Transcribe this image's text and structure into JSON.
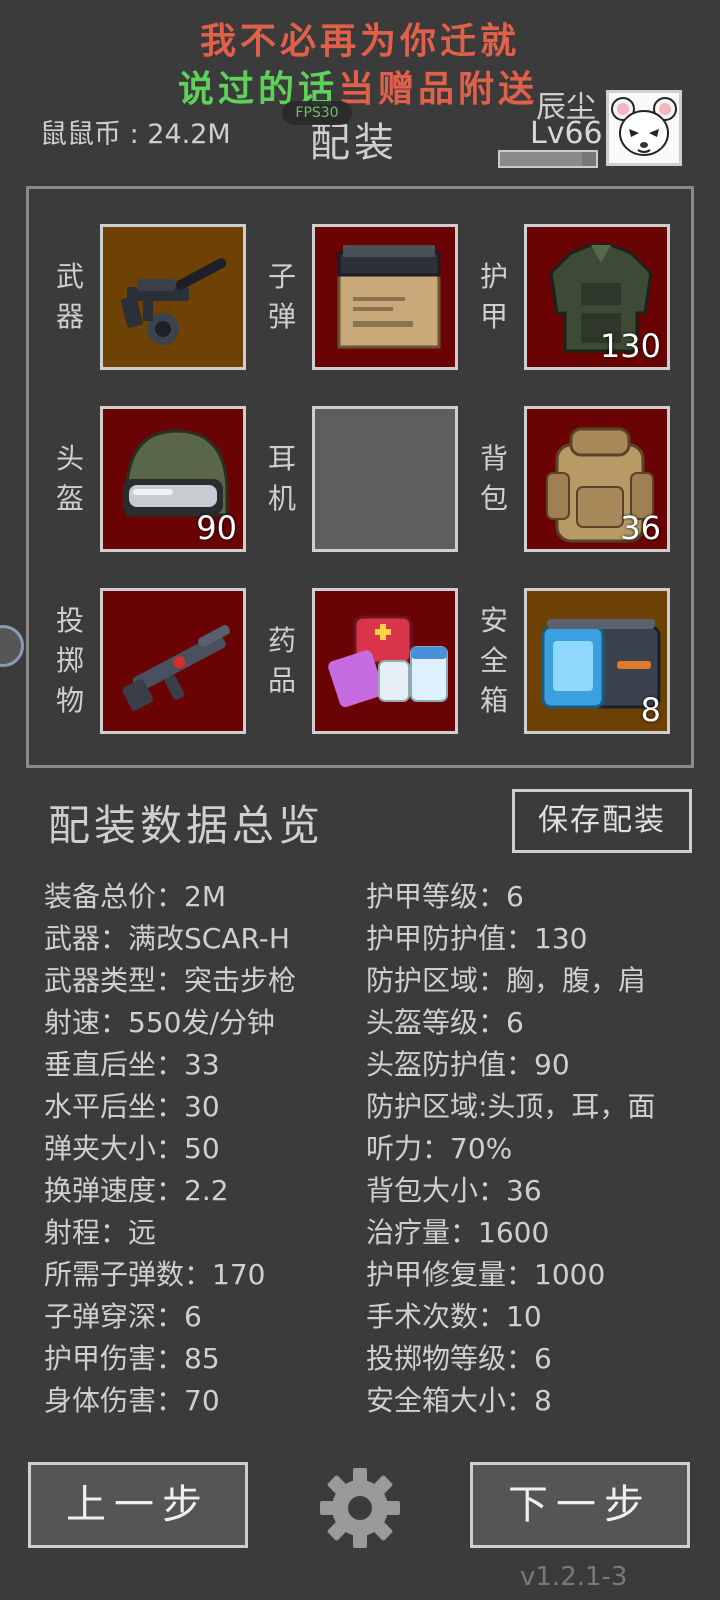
{
  "banner": {
    "line1": "我不必再为你迁就",
    "line2_green": "说过的话",
    "line2_red": "当赠品附送"
  },
  "header": {
    "coins_label": "鼠鼠币",
    "coins_sep": ":",
    "coins_value": "24.2M",
    "fps": "FPS30",
    "title": "配装",
    "username": "辰尘",
    "level": "Lv66",
    "avatar_icon": "mouse-avatar-icon"
  },
  "slots": [
    {
      "label": "武器",
      "icon": "rifle-icon",
      "bg": "#6e4204",
      "count": ""
    },
    {
      "label": "子弹",
      "icon": "ammo-box-icon",
      "bg": "#6a0404",
      "count": ""
    },
    {
      "label": "护甲",
      "icon": "body-armor-icon",
      "bg": "#6a0404",
      "count": "130"
    },
    {
      "label": "头盔",
      "icon": "helmet-icon",
      "bg": "#6a0404",
      "count": "90"
    },
    {
      "label": "耳机",
      "icon": "",
      "bg": "#5e5e5e",
      "count": ""
    },
    {
      "label": "背包",
      "icon": "backpack-icon",
      "bg": "#6a0404",
      "count": "36"
    },
    {
      "label": "投掷物",
      "icon": "grenade-launcher-icon",
      "bg": "#6a0404",
      "count": ""
    },
    {
      "label": "药品",
      "icon": "medkit-icon",
      "bg": "#6a0404",
      "count": ""
    },
    {
      "label": "安全箱",
      "icon": "safe-box-icon",
      "bg": "#6e4204",
      "count": "8"
    }
  ],
  "summary": {
    "title": "配装数据总览",
    "save_label": "保存配装",
    "left": [
      "装备总价：2M",
      "武器：满改SCAR-H",
      "武器类型：突击步枪",
      "射速：550发/分钟",
      "垂直后坐：33",
      "水平后坐：30",
      "弹夹大小：50",
      "换弹速度：2.2",
      "射程：远",
      "所需子弹数：170",
      "子弹穿深：6",
      "护甲伤害：85",
      "身体伤害：70"
    ],
    "right": [
      "护甲等级：6",
      "护甲防护值：130",
      "防护区域：胸，腹，肩",
      "头盔等级：6",
      "头盔防护值：90",
      "防护区域:头顶，耳，面",
      "听力：70%",
      "背包大小：36",
      "治疗量：1600",
      "护甲修复量：1000",
      "手术次数：10",
      "投掷物等级：6",
      "安全箱大小：8"
    ]
  },
  "footer": {
    "prev_label": "上一步",
    "next_label": "下一步",
    "settings_icon": "gear-icon",
    "version": "v1.2.1-3"
  },
  "xp_progress": 0.85
}
